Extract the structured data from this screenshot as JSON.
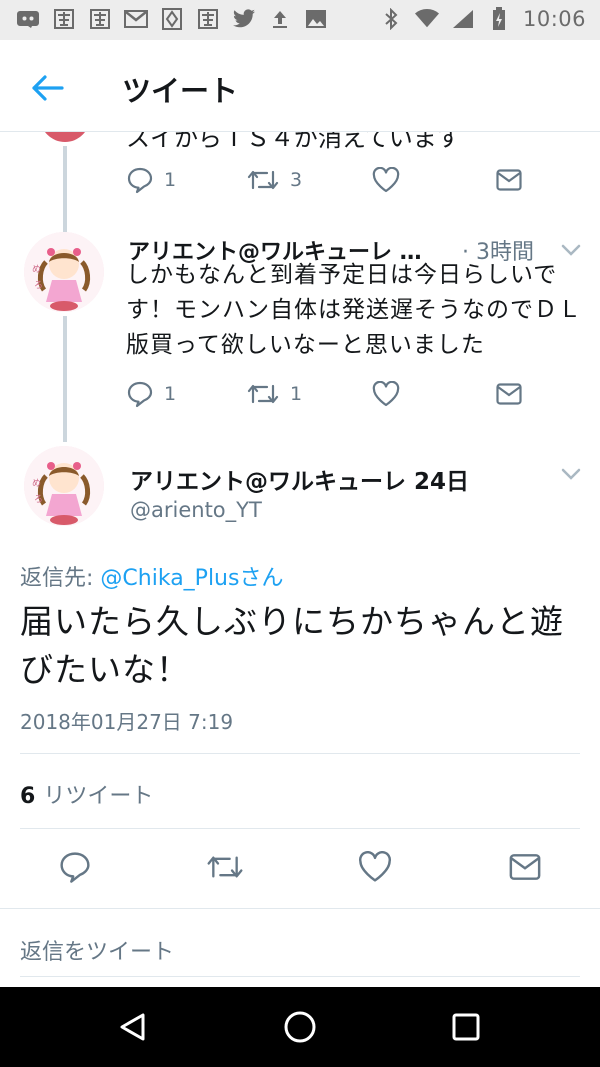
{
  "status_bar": {
    "time": "10:06",
    "left_icons": [
      "discord-icon",
      "kanji-notification-icon",
      "kanji-notification-icon",
      "gmail-icon",
      "pattern-icon",
      "kanji-notification-icon",
      "twitter-bird-icon",
      "upload-icon",
      "image-icon"
    ],
    "right_icons": [
      "bluetooth-icon",
      "wifi-icon",
      "signal-icon",
      "battery-charging-icon"
    ]
  },
  "header": {
    "title": "ツイート"
  },
  "thread": {
    "prev_tweet": {
      "cut_text": "スイからＴＳ４が消えています",
      "replies": "1",
      "retweets": "3"
    },
    "reply_tweet": {
      "name": "アリエント@ワルキューレ …",
      "time": "· 3時間",
      "body": "しかもなんと到着予定日は今日らしいです！モンハン自体は発送遅そうなのでＤＬ版買って欲しいなーと思いました",
      "replies": "1",
      "retweets": "1"
    }
  },
  "main_tweet": {
    "name": "アリエント@ワルキューレ 24日",
    "handle": "@ariento_YT",
    "reply_prefix": "返信先:",
    "reply_target": "@Chika_Plusさん",
    "body": "届いたら久しぶりにちかちゃんと遊びたいな！",
    "date": "2018年01月27日 7:19",
    "retweet_count": "6",
    "retweet_label": "リツイート"
  },
  "reply_box": {
    "placeholder": "返信をツイート"
  },
  "colors": {
    "accent": "#1da1f2",
    "muted": "#657786",
    "text": "#14171a",
    "divider": "#e1e8ed"
  }
}
